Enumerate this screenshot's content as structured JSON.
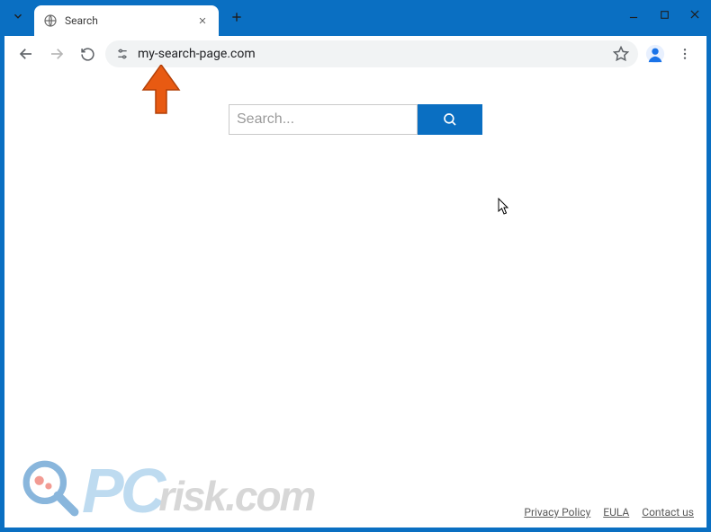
{
  "window": {
    "tab_title": "Search",
    "url": "my-search-page.com"
  },
  "page": {
    "search_placeholder": "Search..."
  },
  "footer": {
    "links": [
      "Privacy Policy",
      "EULA",
      "Contact us"
    ]
  },
  "watermark": {
    "pc": "PC",
    "rest": "risk.com"
  }
}
